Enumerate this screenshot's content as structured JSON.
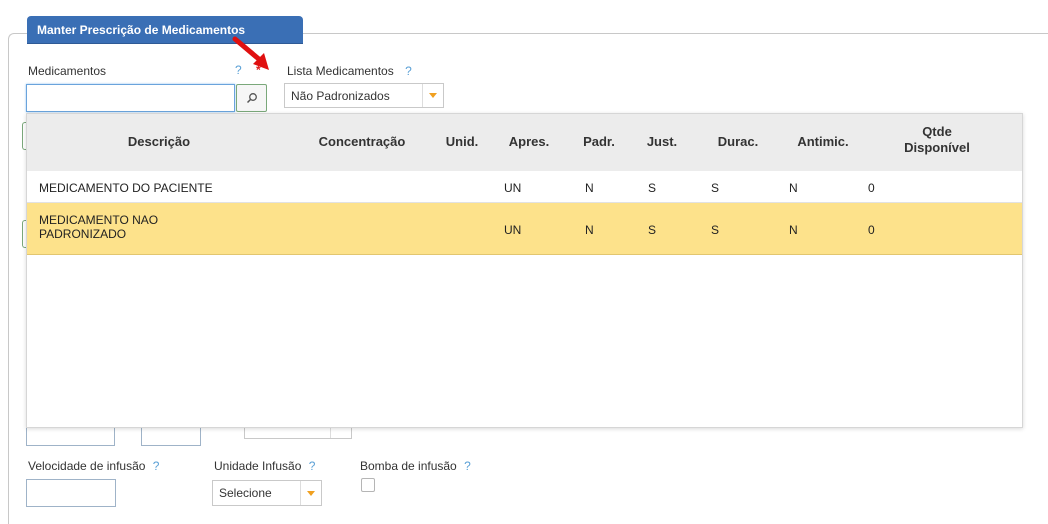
{
  "panel": {
    "title": "Manter Prescrição de Medicamentos"
  },
  "form": {
    "medicamentos_label": "Medicamentos",
    "medicamentos_value": "",
    "help_mark": "?",
    "required_mark": "*",
    "lista_label": "Lista Medicamentos",
    "lista_value": "Não Padronizados",
    "hidden_select_value": "Selecione",
    "velocidade_label": "Velocidade de infusão",
    "unidade_label": "Unidade Infusão",
    "unidade_value": "Selecione",
    "bomba_label": "Bomba de infusão"
  },
  "grid": {
    "columns": [
      "Descrição",
      "Concentração",
      "Unid.",
      "Apres.",
      "Padr.",
      "Just.",
      "Durac.",
      "Antimic.",
      "Qtde",
      "Disponível"
    ],
    "rows": [
      {
        "descricao": "MEDICAMENTO DO PACIENTE",
        "concentracao": "",
        "unid": "",
        "apres": "UN",
        "padr": "N",
        "just": "S",
        "durac": "S",
        "antimic": "N",
        "qtde": "0"
      },
      {
        "descricao": "MEDICAMENTO NAO PADRONIZADO",
        "concentracao": "",
        "unid": "",
        "apres": "UN",
        "padr": "N",
        "just": "S",
        "durac": "S",
        "antimic": "N",
        "qtde": "0"
      }
    ],
    "selected_row_index": 1
  },
  "colors": {
    "header_blue": "#3a6fb5",
    "selected_row": "#fde28b",
    "help": "#5aa0d6",
    "required": "#e02020",
    "arrow": "#e01010",
    "select_arrow": "#f0a020"
  },
  "icons": {
    "search": "search-icon",
    "arrow": "red-arrow-annotation"
  }
}
